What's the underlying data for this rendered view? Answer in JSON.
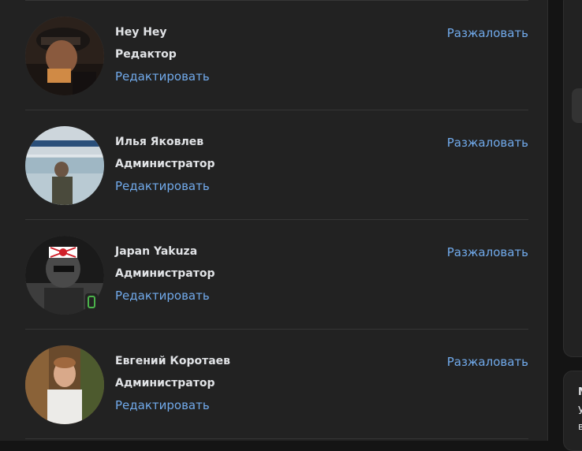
{
  "members": [
    {
      "name": "Hey Hey",
      "role": "Редактор",
      "edit_label": "Редактировать",
      "demote_label": "Разжаловать",
      "online_mobile": false
    },
    {
      "name": "Илья Яковлев",
      "role": "Администратор",
      "edit_label": "Редактировать",
      "demote_label": "Разжаловать",
      "online_mobile": false
    },
    {
      "name": "Japan Yakuza",
      "role": "Администратор",
      "edit_label": "Редактировать",
      "demote_label": "Разжаловать",
      "online_mobile": true
    },
    {
      "name": "Евгений Коротаев",
      "role": "Администратор",
      "edit_label": "Редактировать",
      "demote_label": "Разжаловать",
      "online_mobile": false
    }
  ],
  "sidebar": {
    "text_line_1": "М",
    "text_line_2": "У",
    "text_line_3": "в"
  },
  "colors": {
    "background": "#141414",
    "panel": "#222222",
    "link": "#71aaeb",
    "text": "#e1e3e6",
    "online": "#4bb34b"
  }
}
